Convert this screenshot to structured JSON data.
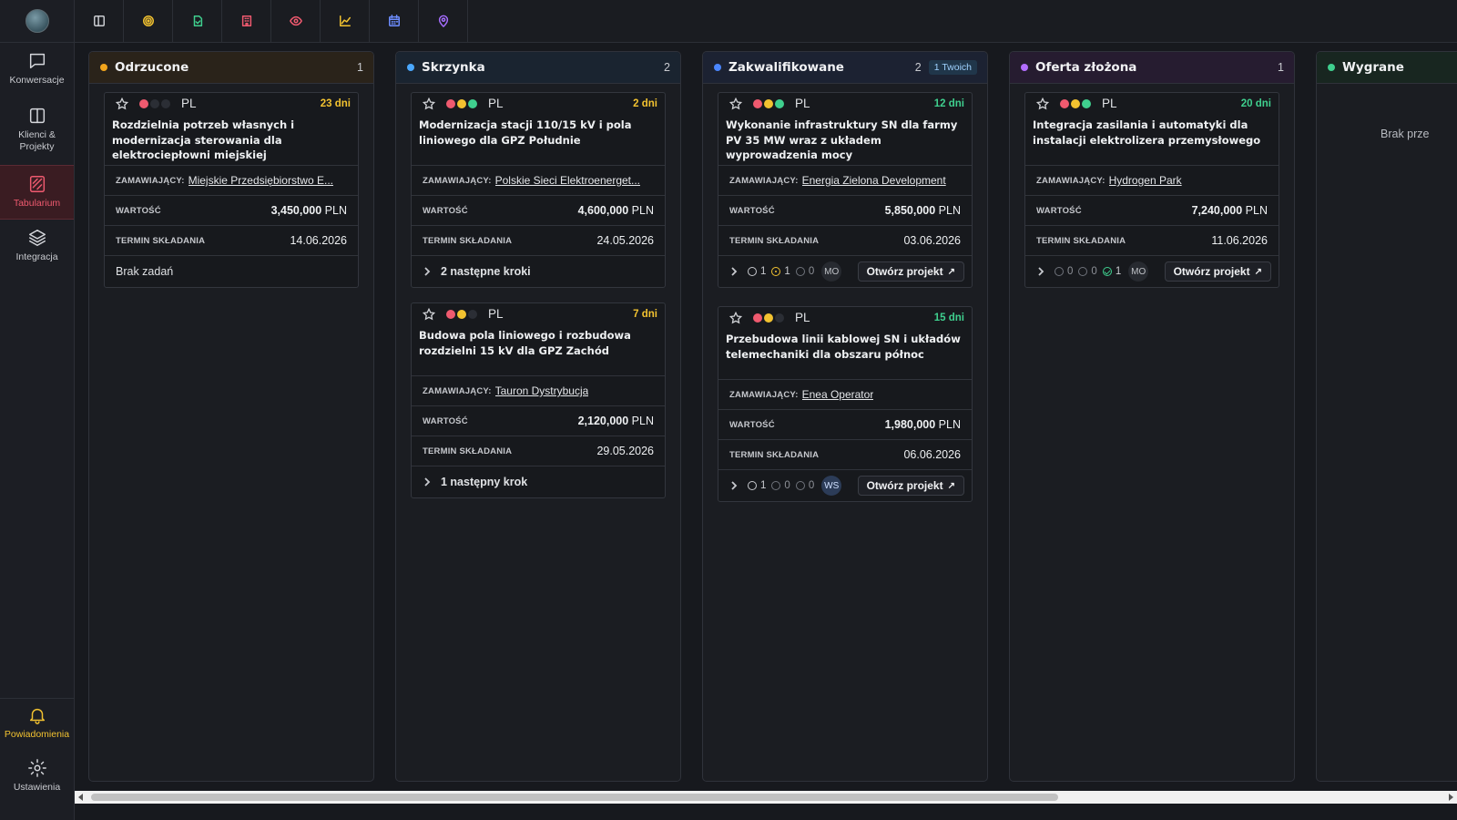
{
  "sidebar": {
    "items": [
      {
        "label": "Konwersacje",
        "icon": "chat-icon"
      },
      {
        "label": "Klienci & Projekty",
        "icon": "columns-icon"
      },
      {
        "label": "Tabularium",
        "icon": "tabularium-icon",
        "active": true
      },
      {
        "label": "Integracja",
        "icon": "layers-icon"
      }
    ],
    "bottom": [
      {
        "label": "Powiadomienia",
        "icon": "bell-icon"
      },
      {
        "label": "Ustawienia",
        "icon": "gear-icon"
      }
    ]
  },
  "toolbar": {
    "icons": [
      {
        "name": "panel-icon",
        "color": "#c9cbd0"
      },
      {
        "name": "target-icon",
        "color": "#f2c230"
      },
      {
        "name": "document-icon",
        "color": "#3fcf8e"
      },
      {
        "name": "building-icon",
        "color": "#ef5a6f"
      },
      {
        "name": "eye-icon",
        "color": "#ef5a6f"
      },
      {
        "name": "chart-icon",
        "color": "#f2c230"
      },
      {
        "name": "calendar-icon",
        "color": "#6d8dff"
      },
      {
        "name": "map-pin-icon",
        "color": "#a66dff"
      }
    ]
  },
  "labels": {
    "client": "ZAMAWIAJĄCY:",
    "value": "WARTOŚĆ",
    "deadline": "TERMIN SKŁADANIA",
    "open_project": "Otwórz projekt",
    "open_arrow": "↗"
  },
  "columns": [
    {
      "title": "Odrzucone",
      "count": "1",
      "dot": "#f2a51c",
      "head_bg": "#2a231a",
      "cards": [
        {
          "lang": "PL",
          "days": "23 dni",
          "days_color": "#f2c230",
          "dots": [
            "#ef5a6f",
            "#2b2e35",
            "#2b2e35"
          ],
          "title": "Rozdzielnia potrzeb własnych i modernizacja sterowania dla elektrociepłowni miejskiej",
          "client": "Miejskie Przedsiębiorstwo E...",
          "value_num": "3,450,000",
          "value_cur": "PLN",
          "deadline": "14.06.2026",
          "footer": {
            "type": "text",
            "text": "Brak zadań"
          }
        }
      ]
    },
    {
      "title": "Skrzynka",
      "count": "2",
      "dot": "#4aa8ff",
      "head_bg": "#1a2430",
      "cards": [
        {
          "lang": "PL",
          "days": "2 dni",
          "days_color": "#f2c230",
          "dots": [
            "#ef5a6f",
            "#f2c230",
            "#3fcf8e"
          ],
          "title": "Modernizacja stacji 110/15 kV i pola liniowego dla GPZ Południe",
          "client": "Polskie Sieci Elektroenerget...",
          "value_num": "4,600,000",
          "value_cur": "PLN",
          "deadline": "24.05.2026",
          "footer": {
            "type": "steps",
            "text": "2 następne kroki"
          }
        },
        {
          "lang": "PL",
          "days": "7 dni",
          "days_color": "#f2c230",
          "dots": [
            "#ef5a6f",
            "#f2c230",
            "#2b2e35"
          ],
          "title": "Budowa pola liniowego i rozbudowa rozdzielni 15 kV dla GPZ Zachód",
          "client": "Tauron Dystrybucja",
          "value_num": "2,120,000",
          "value_cur": "PLN",
          "deadline": "29.05.2026",
          "footer": {
            "type": "steps",
            "text": "1 następny krok"
          }
        }
      ]
    },
    {
      "title": "Zakwalifikowane",
      "count": "2",
      "badge": "1 Twoich",
      "dot": "#4a86ff",
      "head_bg": "#1c2232",
      "cards": [
        {
          "lang": "PL",
          "days": "12 dni",
          "days_color": "#3fcf8e",
          "dots": [
            "#ef5a6f",
            "#f2c230",
            "#3fcf8e"
          ],
          "title": "Wykonanie infrastruktury SN dla farmy PV 35 MW wraz z układem wyprowadzenia mocy",
          "client": "Energia Zielona Development",
          "value_num": "5,850,000",
          "value_cur": "PLN",
          "deadline": "03.06.2026",
          "footer": {
            "type": "tasks",
            "todo": "1",
            "progress": "1",
            "done": "0",
            "avatar": "MO"
          }
        },
        {
          "lang": "PL",
          "days": "15 dni",
          "days_color": "#3fcf8e",
          "dots": [
            "#ef5a6f",
            "#f2c230",
            "#2b2e35"
          ],
          "title": "Przebudowa linii kablowej SN i układów telemechaniki dla obszaru północ",
          "client": "Enea Operator",
          "value_num": "1,980,000",
          "value_cur": "PLN",
          "deadline": "06.06.2026",
          "footer": {
            "type": "tasks",
            "todo": "1",
            "progress": "0",
            "done": "0",
            "avatar": "WS"
          }
        }
      ]
    },
    {
      "title": "Oferta złożona",
      "count": "1",
      "dot": "#b36dff",
      "head_bg": "#261c30",
      "cards": [
        {
          "lang": "PL",
          "days": "20 dni",
          "days_color": "#3fcf8e",
          "dots": [
            "#ef5a6f",
            "#f2c230",
            "#3fcf8e"
          ],
          "title": "Integracja zasilania i automatyki dla instalacji elektrolizera przemysłowego",
          "client": "Hydrogen Park",
          "value_num": "7,240,000",
          "value_cur": "PLN",
          "deadline": "11.06.2026",
          "footer": {
            "type": "tasks",
            "todo": "0",
            "progress": "0",
            "done": "1",
            "avatar": "MO"
          }
        }
      ]
    },
    {
      "title": "Wygrane",
      "count": "",
      "dot": "#3fcf8e",
      "head_bg": "#182620",
      "empty": "Brak prze",
      "cards": []
    }
  ]
}
